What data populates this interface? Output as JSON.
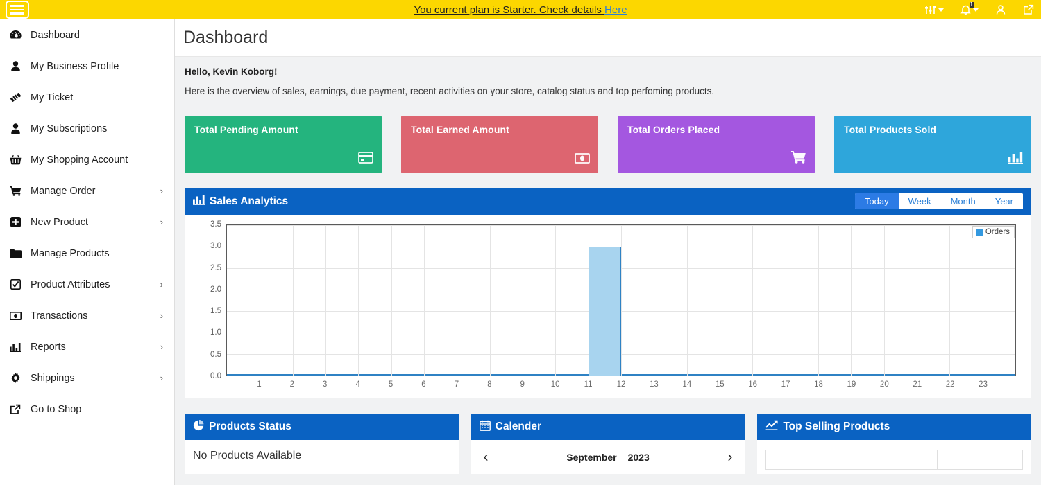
{
  "topbar": {
    "menu_icon": "hamburger-icon",
    "banner_text": "You current plan is Starter. Check details ",
    "banner_link": "Here",
    "icons": [
      {
        "name": "sliders-icon",
        "glyph": "⅐",
        "badge": ""
      },
      {
        "name": "bell-icon",
        "glyph": "⅐",
        "badge": "1"
      },
      {
        "name": "user-icon",
        "glyph": "⅐",
        "badge": ""
      },
      {
        "name": "external-link-icon",
        "glyph": "⅐",
        "badge": ""
      }
    ]
  },
  "sidebar": {
    "items": [
      {
        "label": "Dashboard",
        "icon": "dashboard-icon",
        "chevron": ""
      },
      {
        "label": "My Business Profile",
        "icon": "user-icon",
        "chevron": ""
      },
      {
        "label": "My Ticket",
        "icon": "ticket-icon",
        "chevron": ""
      },
      {
        "label": "My Subscriptions",
        "icon": "user-icon",
        "chevron": ""
      },
      {
        "label": "My Shopping Account",
        "icon": "basket-icon",
        "chevron": ""
      },
      {
        "label": "Manage Order",
        "icon": "cart-icon",
        "chevron": "›"
      },
      {
        "label": "New Product",
        "icon": "plus-square-icon",
        "chevron": "›"
      },
      {
        "label": "Manage Products",
        "icon": "folder-icon",
        "chevron": ""
      },
      {
        "label": "Product Attributes",
        "icon": "check-square-icon",
        "chevron": "›"
      },
      {
        "label": "Transactions",
        "icon": "money-icon",
        "chevron": "›"
      },
      {
        "label": "Reports",
        "icon": "bar-chart-icon",
        "chevron": "›"
      },
      {
        "label": "Shippings",
        "icon": "gear-icon",
        "chevron": "›"
      },
      {
        "label": "Go to Shop",
        "icon": "external-link-icon",
        "chevron": ""
      }
    ]
  },
  "page": {
    "title": "Dashboard",
    "hello": "Hello, Kevin Koborg!",
    "subtitle": "Here is the overview of sales, earnings, due payment, recent activities on your store, catalog status and top perfoming products."
  },
  "cards": [
    {
      "title": "Total Pending Amount",
      "color": "#24b47e",
      "icon": "credit-card-icon"
    },
    {
      "title": "Total Earned Amount",
      "color": "#dd6570",
      "icon": "money-bill-icon"
    },
    {
      "title": "Total Orders Placed",
      "color": "#a457e0",
      "icon": "cart-icon"
    },
    {
      "title": "Total Products Sold",
      "color": "#2ea6db",
      "icon": "bar-chart-icon"
    }
  ],
  "sales_panel": {
    "title": "Sales Analytics",
    "icon": "bar-chart-icon",
    "range_buttons": [
      {
        "label": "Today",
        "active": true
      },
      {
        "label": "Week",
        "active": false
      },
      {
        "label": "Month",
        "active": false
      },
      {
        "label": "Year",
        "active": false
      }
    ]
  },
  "chart_data": {
    "type": "bar",
    "title": "Sales Analytics",
    "xlabel": "",
    "ylabel": "",
    "categories": [
      1,
      2,
      3,
      4,
      5,
      6,
      7,
      8,
      9,
      10,
      11,
      12,
      13,
      14,
      15,
      16,
      17,
      18,
      19,
      20,
      21,
      22,
      23
    ],
    "series": [
      {
        "name": "Orders",
        "color": "#a8d4ef",
        "edge_color": "#2f82c4",
        "values": [
          0,
          0,
          0,
          0,
          0,
          0,
          0,
          0,
          0,
          0,
          3,
          0,
          0,
          0,
          0,
          0,
          0,
          0,
          0,
          0,
          0,
          0,
          0
        ]
      }
    ],
    "ylim": [
      0,
      3.5
    ],
    "yticks": [
      "0.0",
      "0.5",
      "1.0",
      "1.5",
      "2.0",
      "2.5",
      "3.0",
      "3.5"
    ],
    "xticks": [
      "1",
      "2",
      "3",
      "4",
      "5",
      "6",
      "7",
      "8",
      "9",
      "10",
      "11",
      "12",
      "13",
      "14",
      "15",
      "16",
      "17",
      "18",
      "19",
      "20",
      "21",
      "22",
      "23"
    ],
    "grid": true,
    "legend_position": "top-right",
    "legend": [
      "Orders"
    ]
  },
  "bottom_panels": {
    "products_status": {
      "title": "Products Status",
      "icon": "pie-chart-icon",
      "empty_text": "No Products Available"
    },
    "calendar": {
      "title": "Calender",
      "icon": "calendar-icon",
      "prev": "‹",
      "next": "›",
      "month": "September",
      "year": "2023"
    },
    "top_selling": {
      "title": "Top Selling Products",
      "icon": "line-chart-icon",
      "columns": [
        "",
        "",
        ""
      ]
    }
  }
}
